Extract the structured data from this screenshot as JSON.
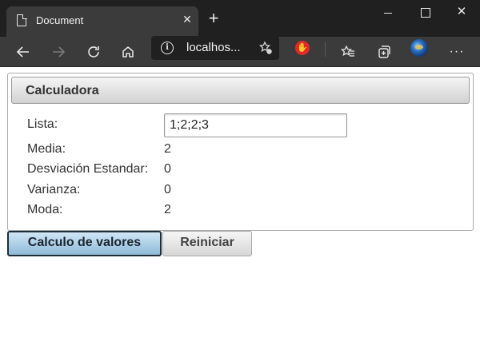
{
  "browser": {
    "tab_title": "Document",
    "tab_close": "✕",
    "new_tab": "+",
    "address": "localhos...",
    "window_minimize": "",
    "window_maximize": "",
    "window_close": "✕",
    "toolbar_icons": [
      "back-arrow-icon",
      "forward-arrow-icon",
      "refresh-icon",
      "home-icon",
      "site-info-icon",
      "add-favorite-icon",
      "extension-icon",
      "favorites-icon",
      "collections-icon",
      "profile-avatar-icon",
      "more-icon"
    ]
  },
  "calculator": {
    "title": "Calculadora",
    "rows": [
      {
        "label": "Lista:",
        "value": "1;2;2;3"
      },
      {
        "label": "Media:",
        "value": "2"
      },
      {
        "label": "Desviación Estandar:",
        "value": "0"
      },
      {
        "label": "Varianza:",
        "value": "0"
      },
      {
        "label": "Moda:",
        "value": "2"
      }
    ]
  },
  "buttons": {
    "calculate": "Calculo de valores",
    "reset": "Reiniciar"
  },
  "colors": {
    "chrome_dark": "#202020",
    "toolbar": "#3b3b3b",
    "panel_header_top": "#f4f4f4",
    "panel_header_bottom": "#d2d2d2",
    "calc_button_top": "#cfe6f5",
    "calc_button_bottom": "#8fbad8",
    "extension_red": "#e02a2a"
  }
}
